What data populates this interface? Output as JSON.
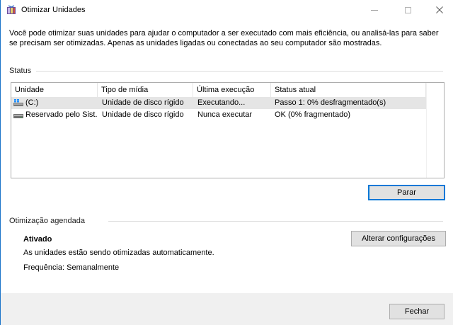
{
  "window": {
    "title": "Otimizar Unidades",
    "controls": {
      "minimize": "minimize-icon",
      "maximize": "maximize-icon",
      "close": "close-icon"
    }
  },
  "intro": "Você pode otimizar suas unidades para ajudar o computador a ser executado com mais eficiência, ou analisá-las para saber se precisam ser otimizadas. Apenas as unidades ligadas ou conectadas ao seu computador são mostradas.",
  "status": {
    "heading": "Status",
    "columns": [
      "Unidade",
      "Tipo de mídia",
      "Última execução",
      "Status atual"
    ],
    "rows": [
      {
        "unit": "(C:)",
        "media": "Unidade de disco rígido",
        "last_run": "Executando...",
        "status": "Passo 1: 0% desfragmentado(s)",
        "icon": "windows-drive-icon",
        "selected": true
      },
      {
        "unit": "Reservado pelo Sist...",
        "media": "Unidade de disco rígido",
        "last_run": "Nunca executar",
        "status": "OK (0% fragmentado)",
        "icon": "hard-drive-icon",
        "selected": false
      }
    ],
    "stop_button": "Parar"
  },
  "scheduled": {
    "heading": "Otimização agendada",
    "state": "Ativado",
    "description": "As unidades estão sendo otimizadas automaticamente.",
    "frequency": "Frequência: Semanalmente",
    "change_button": "Alterar configurações"
  },
  "footer": {
    "close_button": "Fechar"
  },
  "colors": {
    "accent": "#0078d7",
    "window_border": "#1a73c9",
    "selected_row": "#e5e5e5",
    "button_face": "#e1e1e1"
  }
}
